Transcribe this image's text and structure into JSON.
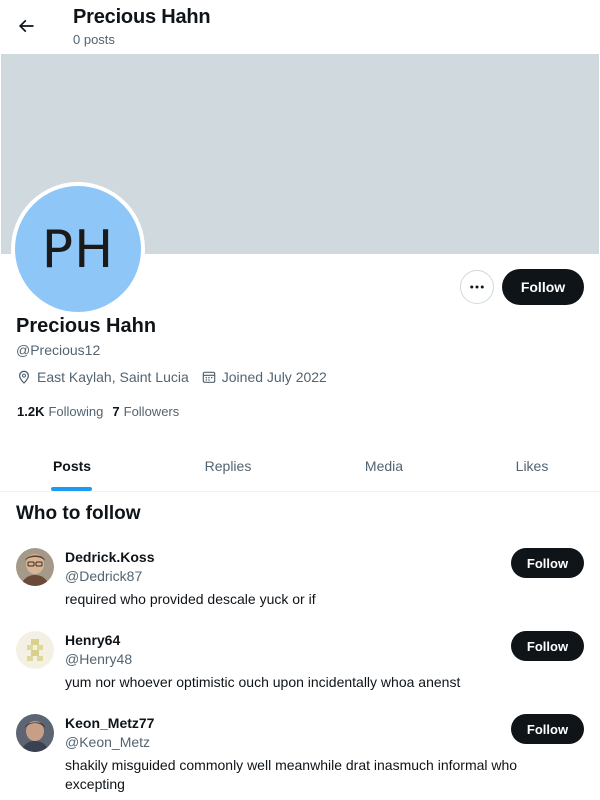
{
  "header": {
    "title": "Precious Hahn",
    "posts_count": "0 posts"
  },
  "profile": {
    "avatar_initials": "PH",
    "avatar_color": "#8ec7f7",
    "banner_color": "#cfd9de",
    "display_name": "Precious Hahn",
    "handle": "@Precious12",
    "location": "East Kaylah, Saint Lucia",
    "joined": "Joined July 2022",
    "following_count": "1.2K",
    "following_label": "Following",
    "followers_count": "7",
    "followers_label": "Followers",
    "follow_label": "Follow"
  },
  "tabs": [
    {
      "label": "Posts",
      "active": true
    },
    {
      "label": "Replies",
      "active": false
    },
    {
      "label": "Media",
      "active": false
    },
    {
      "label": "Likes",
      "active": false
    }
  ],
  "who_to_follow": {
    "title": "Who to follow",
    "users": [
      {
        "name": "Dedrick.Koss",
        "handle": "@Dedrick87",
        "bio": "required who provided descale yuck or if",
        "follow_label": "Follow"
      },
      {
        "name": "Henry64",
        "handle": "@Henry48",
        "bio": "yum nor whoever optimistic ouch upon incidentally whoa anenst",
        "follow_label": "Follow"
      },
      {
        "name": "Keon_Metz77",
        "handle": "@Keon_Metz",
        "bio": "shakily misguided commonly well meanwhile drat inasmuch informal who excepting",
        "follow_label": "Follow"
      }
    ]
  },
  "colors": {
    "accent": "#1d9bf0",
    "button_dark": "#0f1419",
    "muted_text": "#536471"
  }
}
